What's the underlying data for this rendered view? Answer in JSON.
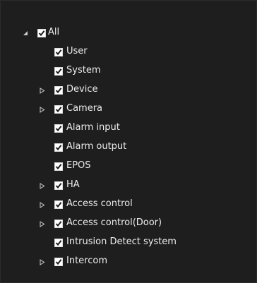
{
  "tree": {
    "root": {
      "label": "All",
      "expanded": true,
      "checked": true
    },
    "items": [
      {
        "label": "User",
        "checked": true,
        "has_children": false
      },
      {
        "label": "System",
        "checked": true,
        "has_children": false
      },
      {
        "label": "Device",
        "checked": true,
        "has_children": true
      },
      {
        "label": "Camera",
        "checked": true,
        "has_children": true
      },
      {
        "label": "Alarm input",
        "checked": true,
        "has_children": false
      },
      {
        "label": "Alarm output",
        "checked": true,
        "has_children": false
      },
      {
        "label": "EPOS",
        "checked": true,
        "has_children": false
      },
      {
        "label": "HA",
        "checked": true,
        "has_children": true
      },
      {
        "label": "Access control",
        "checked": true,
        "has_children": true
      },
      {
        "label": "Access control(Door)",
        "checked": true,
        "has_children": true
      },
      {
        "label": "Intrusion Detect system",
        "checked": true,
        "has_children": false
      },
      {
        "label": "Intercom",
        "checked": true,
        "has_children": true
      }
    ]
  },
  "icons": {
    "expanded": "triangle-expanded-icon",
    "collapsed": "triangle-collapsed-icon",
    "checked": "checkmark-icon"
  },
  "colors": {
    "background": "#1e1e1e",
    "text": "#ececec",
    "checkbox_fill": "#ffffff",
    "check_mark": "#1a1a1a",
    "expander": "#cfcfcf"
  }
}
